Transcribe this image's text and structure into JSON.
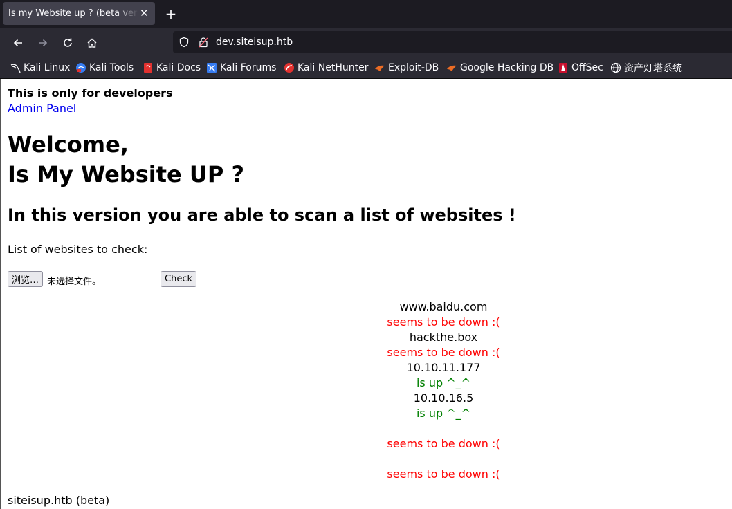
{
  "browser": {
    "tab_title": "Is my Website up ? (beta version)",
    "url": "dev.siteisup.htb",
    "bookmarks": [
      "Kali Linux",
      "Kali Tools",
      "Kali Docs",
      "Kali Forums",
      "Kali NetHunter",
      "Exploit-DB",
      "Google Hacking DB",
      "OffSec",
      "资产灯塔系统"
    ]
  },
  "page": {
    "dev_note": "This is only for developers",
    "admin_link": "Admin Panel",
    "welcome": "Welcome,",
    "heading": "Is My Website UP ?",
    "subheading": "In this version you are able to scan a list of websites !",
    "list_label": "List of websites to check:",
    "browse_button": "浏览…",
    "no_file_text": "未选择文件。",
    "check_button": "Check",
    "results": [
      {
        "site": "www.baidu.com",
        "status": "seems to be down :("
      },
      {
        "site": "hackthe.box",
        "status": "seems to be down :("
      },
      {
        "site": "10.10.11.177",
        "status": "is up ^_^"
      },
      {
        "site": "10.10.16.5",
        "status": "is up ^_^"
      },
      {
        "site": "",
        "status": "seems to be down :("
      },
      {
        "site": "",
        "status": "seems to be down :("
      }
    ],
    "footer": "siteisup.htb (beta)"
  },
  "colors": {
    "down": "#ff0000",
    "up": "#008000",
    "link": "#0000ee"
  }
}
